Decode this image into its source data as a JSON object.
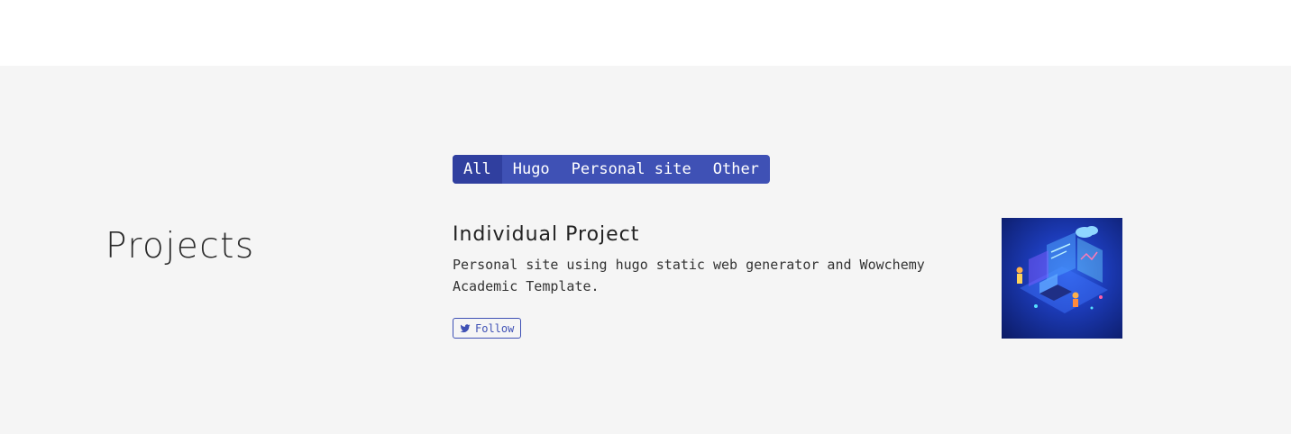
{
  "section": {
    "title": "Projects"
  },
  "filters": [
    {
      "label": "All",
      "active": true
    },
    {
      "label": "Hugo",
      "active": false
    },
    {
      "label": "Personal site",
      "active": false
    },
    {
      "label": "Other",
      "active": false
    }
  ],
  "project": {
    "title": "Individual Project",
    "summary": "Personal site using hugo static web generator and Wowchemy Academic Template.",
    "follow_label": "Follow",
    "follow_icon": "twitter-icon",
    "image": "isometric-data-illustration"
  },
  "colors": {
    "primary": "#3f51b5",
    "primary_active": "#303f9f",
    "section_bg": "#f5f5f5"
  }
}
